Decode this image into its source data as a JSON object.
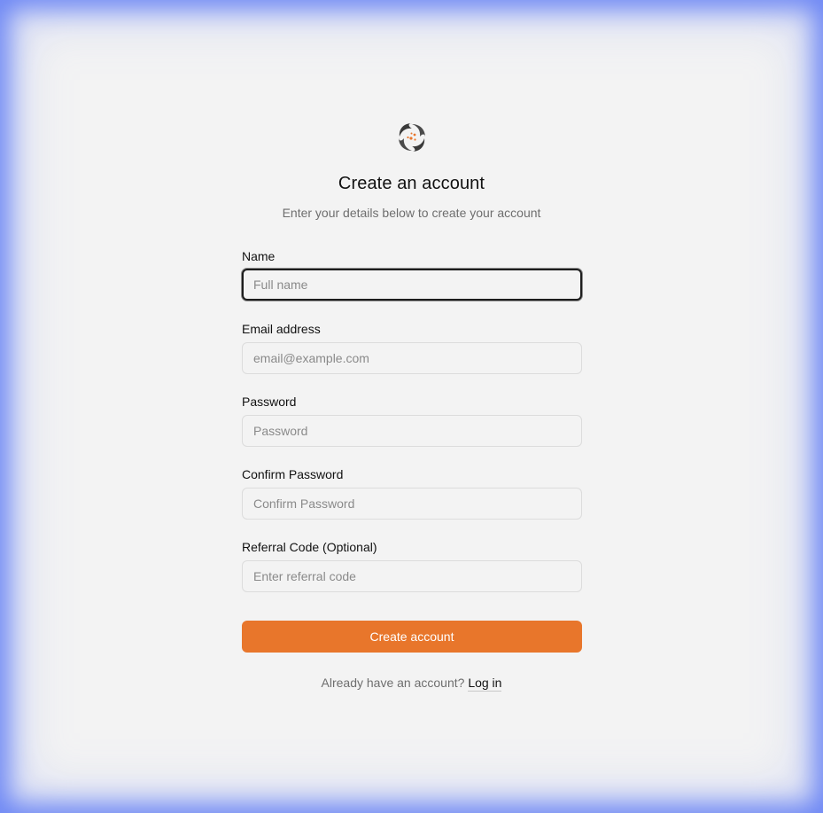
{
  "brand": {
    "logo_icon": "swirl-logo-icon",
    "accent_color": "#e8762b",
    "frame_glow_color": "#5a78f5"
  },
  "header": {
    "title": "Create an account",
    "subtitle": "Enter your details below to create your account"
  },
  "form": {
    "name": {
      "label": "Name",
      "placeholder": "Full name",
      "value": "",
      "focused": true
    },
    "email": {
      "label": "Email address",
      "placeholder": "email@example.com",
      "value": ""
    },
    "password": {
      "label": "Password",
      "placeholder": "Password",
      "value": ""
    },
    "confirm_password": {
      "label": "Confirm Password",
      "placeholder": "Confirm Password",
      "value": ""
    },
    "referral": {
      "label": "Referral Code (Optional)",
      "placeholder": "Enter referral code",
      "value": ""
    },
    "submit_label": "Create account"
  },
  "footer": {
    "prompt": "Already have an account?",
    "link_label": "Log in"
  }
}
